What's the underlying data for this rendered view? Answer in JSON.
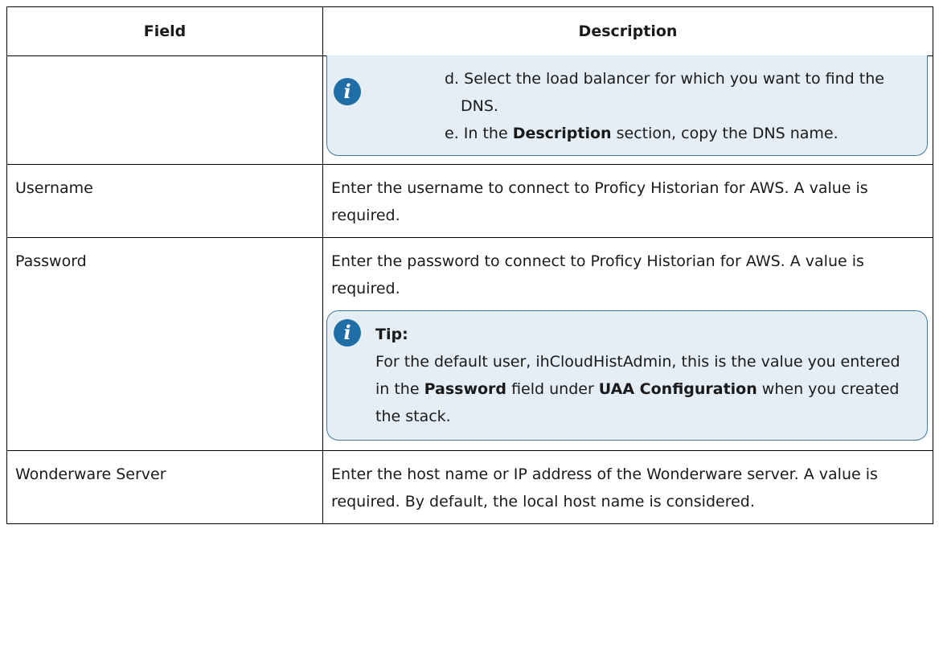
{
  "table": {
    "headers": {
      "field": "Field",
      "description": "Description"
    },
    "rows": {
      "row0": {
        "field": "",
        "note": {
          "step_d_marker": "d.",
          "step_d_text": "Select the load balancer for which you want to find the DNS.",
          "step_e_marker": "e.",
          "step_e_pre": "In the ",
          "step_e_bold": "Description",
          "step_e_post": " section, copy the DNS name."
        }
      },
      "row1": {
        "field": "Username",
        "description": "Enter the username to connect to Proficy Historian for AWS. A value is required."
      },
      "row2": {
        "field": "Password",
        "description": "Enter the password to connect to Proficy Historian for AWS. A value is required.",
        "tip": {
          "title": "Tip:",
          "text_1": "For the default user, ihCloudHistAdmin, this is the value you entered in the ",
          "bold_1": "Password",
          "text_2": " field under ",
          "bold_2": "UAA Configu­ration",
          "text_3": " when you created the stack."
        }
      },
      "row3": {
        "field": "Wonderware Server",
        "description": "Enter the host name or IP address of the Wonderware server. A value is required. By default, the local host name is considered."
      }
    }
  },
  "colors": {
    "note_bg": "#e6eef5",
    "note_border": "#42779c",
    "icon": "#1f6ea8"
  },
  "icons": {
    "info": "info-icon"
  }
}
